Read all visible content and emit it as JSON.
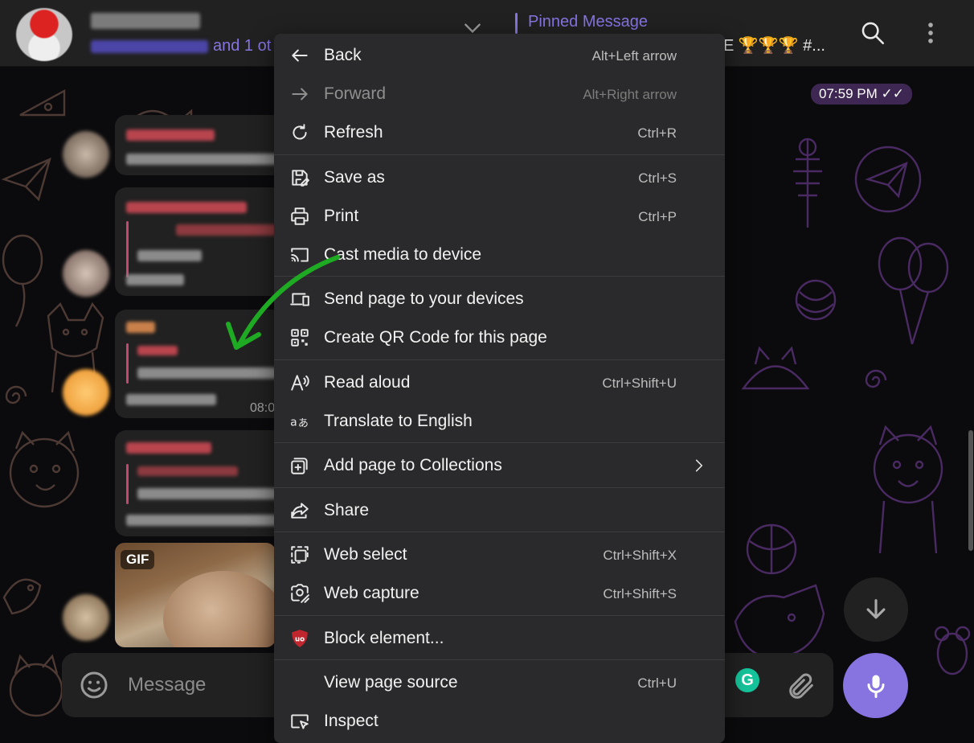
{
  "header": {
    "members_text": "and 1 ot",
    "pinned_label": "Pinned Message",
    "pinned_preview_tail": "E 🏆🏆🏆 #..."
  },
  "chat": {
    "time_chip": "07:59 PM ✓✓",
    "bubble_time": "08:0",
    "gif_badge": "GIF",
    "composer_placeholder": "Message"
  },
  "context_menu": {
    "items": [
      {
        "label": "Back",
        "shortcut": "Alt+Left arrow",
        "icon": "back-arrow-icon"
      },
      {
        "label": "Forward",
        "shortcut": "Alt+Right arrow",
        "icon": "forward-arrow-icon",
        "disabled": true
      },
      {
        "label": "Refresh",
        "shortcut": "Ctrl+R",
        "icon": "refresh-icon"
      },
      {
        "label": "Save as",
        "shortcut": "Ctrl+S",
        "icon": "save-icon"
      },
      {
        "label": "Print",
        "shortcut": "Ctrl+P",
        "icon": "print-icon"
      },
      {
        "label": "Cast media to device",
        "shortcut": "",
        "icon": "cast-icon"
      },
      {
        "label": "Send page to your devices",
        "shortcut": "",
        "icon": "devices-icon"
      },
      {
        "label": "Create QR Code for this page",
        "shortcut": "",
        "icon": "qr-code-icon"
      },
      {
        "label": "Read aloud",
        "shortcut": "Ctrl+Shift+U",
        "icon": "read-aloud-icon"
      },
      {
        "label": "Translate to English",
        "shortcut": "",
        "icon": "translate-icon"
      },
      {
        "label": "Add page to Collections",
        "shortcut": "",
        "icon": "collections-icon"
      },
      {
        "label": "Share",
        "shortcut": "",
        "icon": "share-icon"
      },
      {
        "label": "Web select",
        "shortcut": "Ctrl+Shift+X",
        "icon": "web-select-icon"
      },
      {
        "label": "Web capture",
        "shortcut": "Ctrl+Shift+S",
        "icon": "web-capture-icon"
      },
      {
        "label": "Block element...",
        "shortcut": "",
        "icon": "ublock-shield-icon"
      },
      {
        "label": "View page source",
        "shortcut": "Ctrl+U",
        "icon": ""
      },
      {
        "label": "Inspect",
        "shortcut": "",
        "icon": "inspect-icon"
      }
    ]
  },
  "colors": {
    "accent": "#8774e1",
    "menu_bg": "#2a2a2c",
    "header_bg": "#212121",
    "annotation_arrow": "#1faa24",
    "ublock_red": "#c0262d"
  }
}
